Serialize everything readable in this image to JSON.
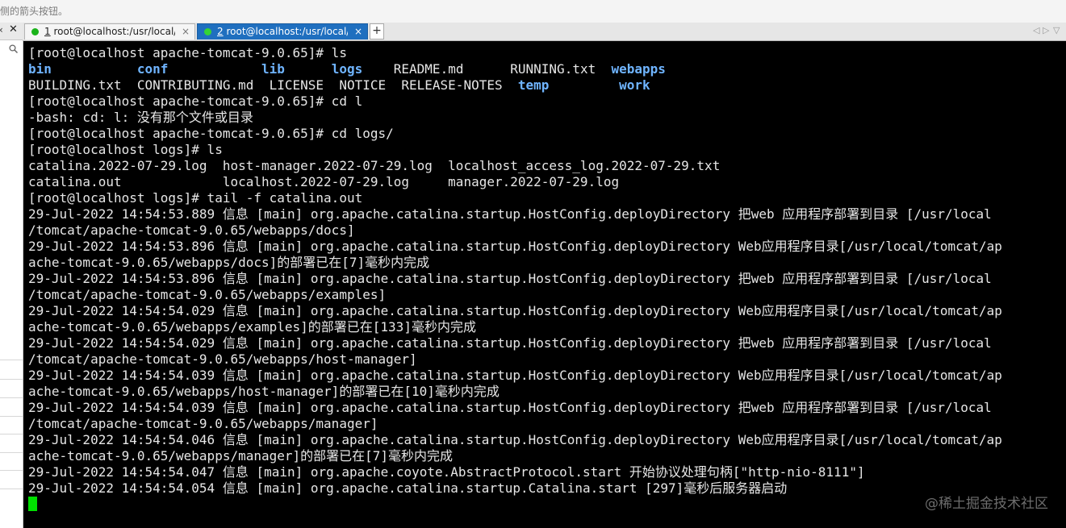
{
  "top_hint": "侧的箭头按钮。",
  "left_panel": {
    "arrow": "‹",
    "close": "✕",
    "search_icon": "search-icon"
  },
  "tabs": [
    {
      "number": "1",
      "label": "root@localhost:/usr/local/to...",
      "close": "×",
      "status_color": "#1bb31b",
      "active": false
    },
    {
      "number": "2",
      "label": "root@localhost:/usr/local/t...",
      "close": "×",
      "status_color": "#35d435",
      "active": true
    }
  ],
  "add_tab": "+",
  "tab_nav": {
    "prev": "◁",
    "next": "▷",
    "menu": "▽"
  },
  "terminal": {
    "lines": [
      [
        {
          "t": "[root@localhost apache-tomcat-9.0.65]# ls"
        }
      ],
      [
        {
          "t": "bin",
          "dir": true
        },
        {
          "t": "           "
        },
        {
          "t": "conf",
          "dir": true
        },
        {
          "t": "            "
        },
        {
          "t": "lib",
          "dir": true
        },
        {
          "t": "      "
        },
        {
          "t": "logs",
          "dir": true
        },
        {
          "t": "    README.md      RUNNING.txt  "
        },
        {
          "t": "webapps",
          "dir": true
        }
      ],
      [
        {
          "t": "BUILDING.txt  CONTRIBUTING.md  LICENSE  NOTICE  RELEASE-NOTES  "
        },
        {
          "t": "temp",
          "dir": true
        },
        {
          "t": "         "
        },
        {
          "t": "work",
          "dir": true
        }
      ],
      [
        {
          "t": "[root@localhost apache-tomcat-9.0.65]# cd l"
        }
      ],
      [
        {
          "t": "-bash: cd: l: 没有那个文件或目录"
        }
      ],
      [
        {
          "t": "[root@localhost apache-tomcat-9.0.65]# cd logs/"
        }
      ],
      [
        {
          "t": "[root@localhost logs]# ls"
        }
      ],
      [
        {
          "t": "catalina.2022-07-29.log  host-manager.2022-07-29.log  localhost_access_log.2022-07-29.txt"
        }
      ],
      [
        {
          "t": "catalina.out             localhost.2022-07-29.log     manager.2022-07-29.log"
        }
      ],
      [
        {
          "t": "[root@localhost logs]# tail -f catalina.out"
        }
      ],
      [
        {
          "t": "29-Jul-2022 14:54:53.889 信息 [main] org.apache.catalina.startup.HostConfig.deployDirectory 把web 应用程序部署到目录 [/usr/local"
        }
      ],
      [
        {
          "t": "/tomcat/apache-tomcat-9.0.65/webapps/docs]"
        }
      ],
      [
        {
          "t": "29-Jul-2022 14:54:53.896 信息 [main] org.apache.catalina.startup.HostConfig.deployDirectory Web应用程序目录[/usr/local/tomcat/ap"
        }
      ],
      [
        {
          "t": "ache-tomcat-9.0.65/webapps/docs]的部署已在[7]毫秒内完成"
        }
      ],
      [
        {
          "t": "29-Jul-2022 14:54:53.896 信息 [main] org.apache.catalina.startup.HostConfig.deployDirectory 把web 应用程序部署到目录 [/usr/local"
        }
      ],
      [
        {
          "t": "/tomcat/apache-tomcat-9.0.65/webapps/examples]"
        }
      ],
      [
        {
          "t": "29-Jul-2022 14:54:54.029 信息 [main] org.apache.catalina.startup.HostConfig.deployDirectory Web应用程序目录[/usr/local/tomcat/ap"
        }
      ],
      [
        {
          "t": "ache-tomcat-9.0.65/webapps/examples]的部署已在[133]毫秒内完成"
        }
      ],
      [
        {
          "t": "29-Jul-2022 14:54:54.029 信息 [main] org.apache.catalina.startup.HostConfig.deployDirectory 把web 应用程序部署到目录 [/usr/local"
        }
      ],
      [
        {
          "t": "/tomcat/apache-tomcat-9.0.65/webapps/host-manager]"
        }
      ],
      [
        {
          "t": "29-Jul-2022 14:54:54.039 信息 [main] org.apache.catalina.startup.HostConfig.deployDirectory Web应用程序目录[/usr/local/tomcat/ap"
        }
      ],
      [
        {
          "t": "ache-tomcat-9.0.65/webapps/host-manager]的部署已在[10]毫秒内完成"
        }
      ],
      [
        {
          "t": "29-Jul-2022 14:54:54.039 信息 [main] org.apache.catalina.startup.HostConfig.deployDirectory 把web 应用程序部署到目录 [/usr/local"
        }
      ],
      [
        {
          "t": "/tomcat/apache-tomcat-9.0.65/webapps/manager]"
        }
      ],
      [
        {
          "t": "29-Jul-2022 14:54:54.046 信息 [main] org.apache.catalina.startup.HostConfig.deployDirectory Web应用程序目录[/usr/local/tomcat/ap"
        }
      ],
      [
        {
          "t": "ache-tomcat-9.0.65/webapps/manager]的部署已在[7]毫秒内完成"
        }
      ],
      [
        {
          "t": "29-Jul-2022 14:54:54.047 信息 [main] org.apache.coyote.AbstractProtocol.start 开始协议处理句柄[\"http-nio-8111\"]"
        }
      ],
      [
        {
          "t": "29-Jul-2022 14:54:54.054 信息 [main] org.apache.catalina.startup.Catalina.start [297]毫秒后服务器启动"
        }
      ]
    ],
    "cursor_color": "#00e000",
    "dir_color": "#6fb4ff"
  },
  "watermark": "@稀土掘金技术社区"
}
